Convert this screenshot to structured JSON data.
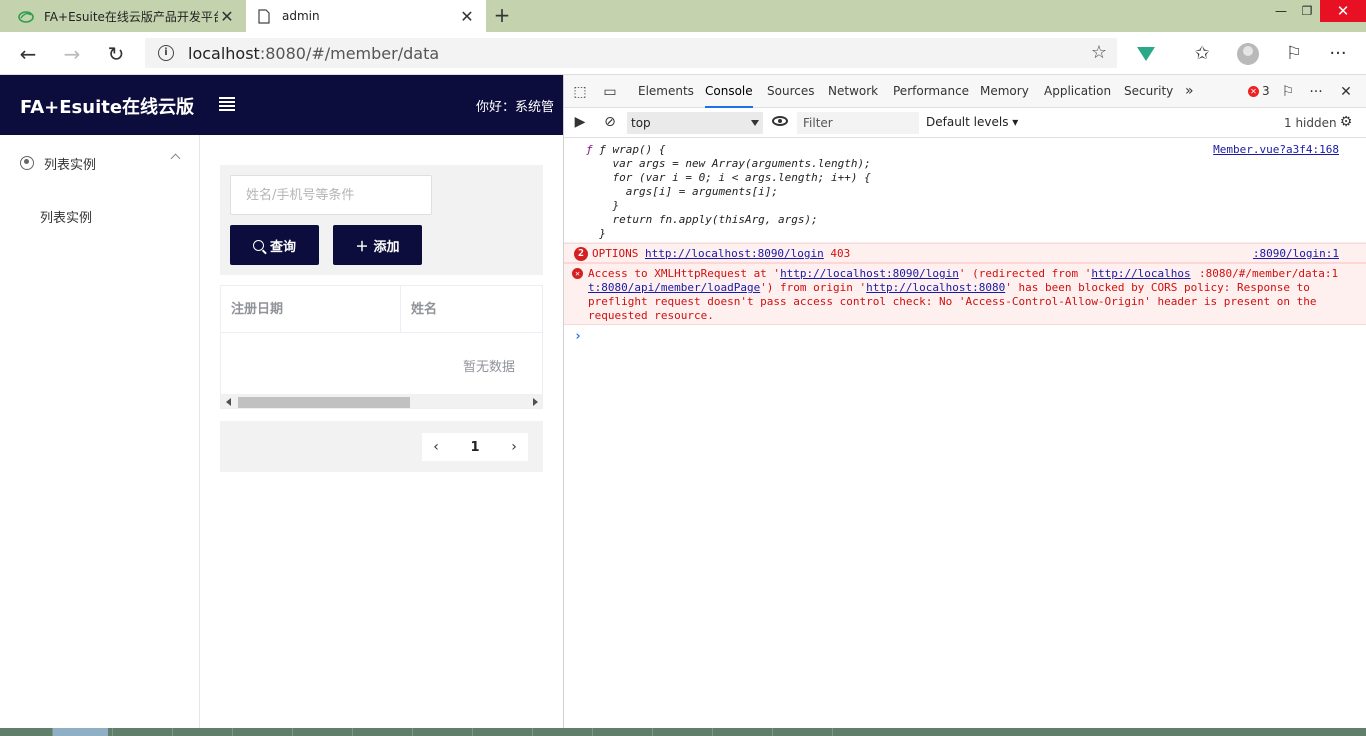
{
  "browser": {
    "tabs": [
      {
        "title": "FA+Esuite在线云版产品开发平台",
        "icon": "leaf-logo-icon"
      },
      {
        "title": "admin",
        "icon": "page-icon"
      }
    ],
    "url_host": "localhost",
    "url_rest": ":8080/#/member/data"
  },
  "app": {
    "brand": "FA+Esuite在线云版",
    "greeting": "你好：系统管",
    "sidebar": {
      "group_label": "列表实例",
      "item_label": "列表实例"
    },
    "search": {
      "placeholder": "姓名/手机号等条件",
      "query_label": "查询",
      "add_label": "添加"
    },
    "table": {
      "columns": [
        "注册日期",
        "姓名"
      ],
      "empty_text": "暂无数据"
    },
    "pagination": {
      "current_page": "1"
    }
  },
  "devtools": {
    "tabs": [
      "Elements",
      "Console",
      "Sources",
      "Network",
      "Performance",
      "Memory",
      "Application",
      "Security"
    ],
    "more": "»",
    "error_count": "3",
    "context": "top",
    "filter_placeholder": "Filter",
    "levels": "Default levels ▾",
    "hidden": "1 hidden",
    "code": {
      "source": "Member.vue?a3f4:168",
      "lines": [
        "ƒ wrap() {",
        "    var args = new Array(arguments.length);",
        "    for (var i = 0; i < args.length; i++) {",
        "      args[i] = arguments[i];",
        "    }",
        "    return fn.apply(thisArg, args);",
        "  }"
      ]
    },
    "error1": {
      "count": "2",
      "method": "OPTIONS",
      "url": "http://localhost:8090/login",
      "status": "403",
      "source": ":8090/login:1"
    },
    "error2": {
      "line1_a": "Access to XMLHttpRequest at '",
      "url1": "http://localhost:8090/login",
      "line1_b": "' (redirected from '",
      "url2a": "http://localhos",
      "line2_a": "t:8080/api/member/loadPage",
      "line2_b": "') from origin '",
      "url3": "http://localhost:8080",
      "line2_c": "' has been blocked by CORS policy: Response to",
      "line3": "preflight request doesn't pass access control check: No 'Access-Control-Allow-Origin' header is present on the",
      "line4": "requested resource.",
      "source_a": ":8080/#/member/data:1"
    }
  }
}
